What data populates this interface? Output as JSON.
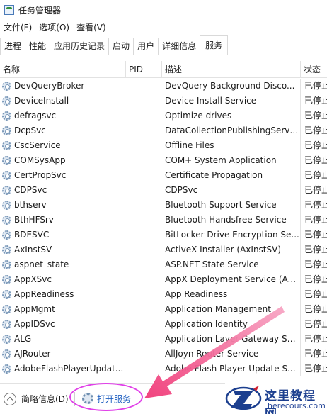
{
  "window": {
    "title": "任务管理器"
  },
  "menu": {
    "items": [
      "文件(F)",
      "选项(O)",
      "查看(V)"
    ]
  },
  "tabs": [
    "进程",
    "性能",
    "应用历史记录",
    "启动",
    "用户",
    "详细信息",
    "服务"
  ],
  "active_tab": "服务",
  "columns": {
    "name": "名称",
    "pid": "PID",
    "desc": "描述",
    "status": "状态"
  },
  "services": [
    {
      "name": "DevQueryBroker",
      "pid": "",
      "desc": "DevQuery Background Disco...",
      "status": "已停止"
    },
    {
      "name": "DeviceInstall",
      "pid": "",
      "desc": "Device Install Service",
      "status": "已停止"
    },
    {
      "name": "defragsvc",
      "pid": "",
      "desc": "Optimize drives",
      "status": "已停止"
    },
    {
      "name": "DcpSvc",
      "pid": "",
      "desc": "DataCollectionPublishingServi...",
      "status": "已停止"
    },
    {
      "name": "CscService",
      "pid": "",
      "desc": "Offline Files",
      "status": "已停止"
    },
    {
      "name": "COMSysApp",
      "pid": "",
      "desc": "COM+ System Application",
      "status": "已停止"
    },
    {
      "name": "CertPropSvc",
      "pid": "",
      "desc": "Certificate Propagation",
      "status": "已停止"
    },
    {
      "name": "CDPSvc",
      "pid": "",
      "desc": "CDPSvc",
      "status": "已停止"
    },
    {
      "name": "bthserv",
      "pid": "",
      "desc": "Bluetooth Support Service",
      "status": "已停止"
    },
    {
      "name": "BthHFSrv",
      "pid": "",
      "desc": "Bluetooth Handsfree Service",
      "status": "已停止"
    },
    {
      "name": "BDESVC",
      "pid": "",
      "desc": "BitLocker Drive Encryption Se...",
      "status": "已停止"
    },
    {
      "name": "AxInstSV",
      "pid": "",
      "desc": "ActiveX Installer (AxInstSV)",
      "status": "已停止"
    },
    {
      "name": "aspnet_state",
      "pid": "",
      "desc": "ASP.NET State Service",
      "status": "已停止"
    },
    {
      "name": "AppXSvc",
      "pid": "",
      "desc": "AppX Deployment Service (A...",
      "status": "已停止"
    },
    {
      "name": "AppReadiness",
      "pid": "",
      "desc": "App Readiness",
      "status": "已停止"
    },
    {
      "name": "AppMgmt",
      "pid": "",
      "desc": "Application Management",
      "status": "已停止"
    },
    {
      "name": "AppIDSvc",
      "pid": "",
      "desc": "Application Identity",
      "status": "已停止"
    },
    {
      "name": "ALG",
      "pid": "",
      "desc": "Application Layer Gateway Se...",
      "status": "已停止"
    },
    {
      "name": "AJRouter",
      "pid": "",
      "desc": "AllJoyn Router Service",
      "status": "已停止"
    },
    {
      "name": "AdobeFlashPlayerUpdat...",
      "pid": "",
      "desc": "Adobe Flash Player Update S...",
      "status": "已停止"
    }
  ],
  "statusbar": {
    "brief_label": "简略信息(D)",
    "open_services_label": "打开服务"
  },
  "watermark": {
    "title": "这里教程网",
    "url": "herecours.com"
  },
  "colors": {
    "link": "#1f5fc0",
    "highlight": "#e040e8",
    "arrow": "#f03a78",
    "watermark": "#1c3f8f"
  }
}
